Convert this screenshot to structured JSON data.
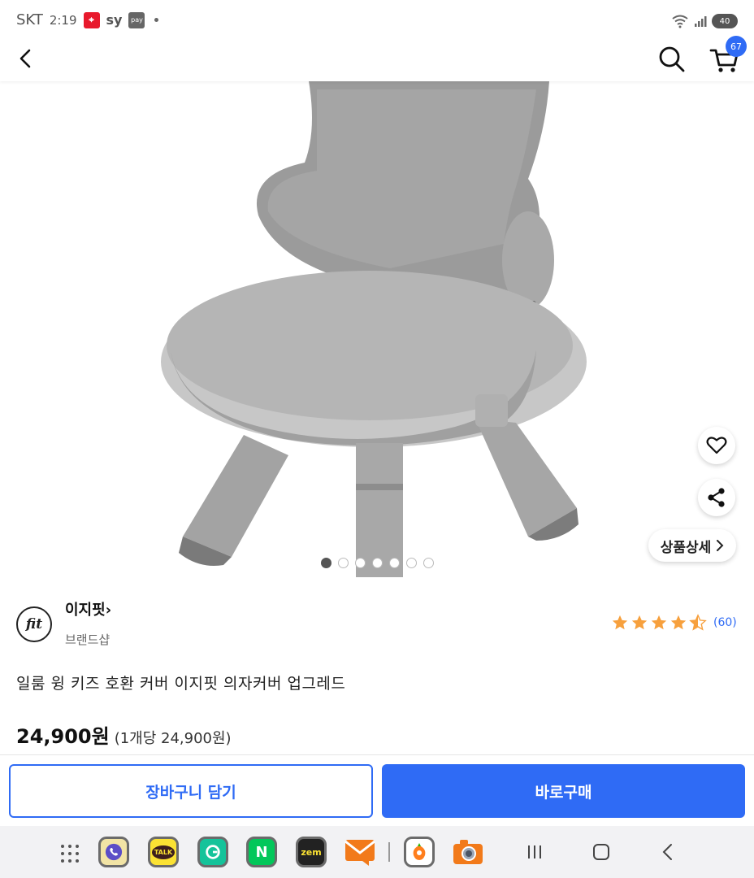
{
  "status_bar": {
    "carrier": "SKT",
    "time": "2:19",
    "sy_label": "sy",
    "pay_label": "pay",
    "battery": "40"
  },
  "header": {
    "cart_count": "67"
  },
  "product_image": {
    "carousel_total": 7,
    "carousel_active": 1
  },
  "floating": {
    "detail_label": "상품상세"
  },
  "brand": {
    "logo_text": "fit",
    "name": "이지핏",
    "sub": "브랜드샵"
  },
  "rating": {
    "stars": 4.5,
    "review_count": "(60)"
  },
  "product": {
    "title": "일룸 윙 키즈 호환 커버 이지핏 의자커버 업그레드",
    "price": "24,900원",
    "unit_price": "(1개당 24,900원)"
  },
  "actions": {
    "add_cart": "장바구니 담기",
    "buy_now": "바로구매"
  },
  "dock": {
    "apps": [
      "phone-app",
      "kakaotalk-app",
      "grammarly-app",
      "naver-app",
      "zem-app",
      "mail-app",
      "carrot-app",
      "camera-app"
    ],
    "talk_label": "TALK",
    "naver_label": "N",
    "zem_label": "zem"
  },
  "colors": {
    "accent": "#2f6bf5",
    "star": "#f7a03d"
  }
}
